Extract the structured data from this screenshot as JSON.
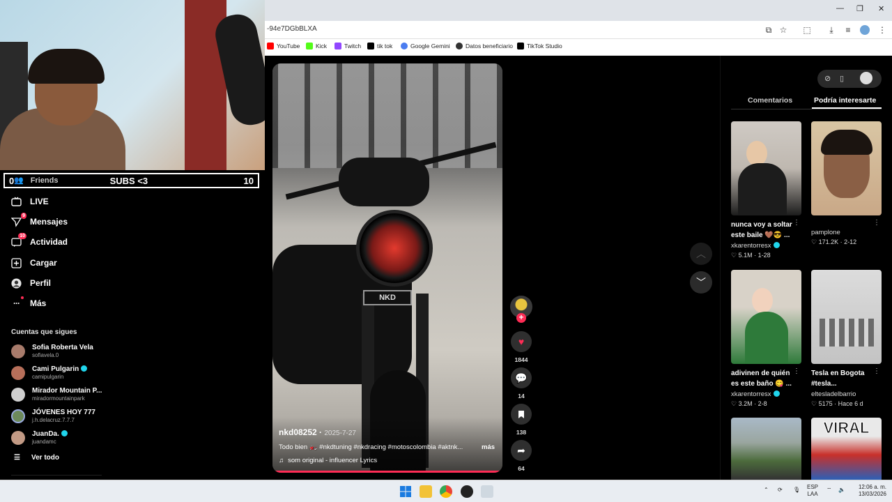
{
  "browser": {
    "url": "-94e7DGbBLXA",
    "window_controls": [
      "—",
      "❐",
      "✕"
    ],
    "bookmarks": [
      {
        "label": "YouTube",
        "color": "#ff0000"
      },
      {
        "label": "Kick",
        "color": "#53fc18"
      },
      {
        "label": "Twitch",
        "color": "#9146ff"
      },
      {
        "label": "tik tok",
        "color": "#000000"
      },
      {
        "label": "Google Gemini",
        "color": "#4a7cf0"
      },
      {
        "label": "Datos beneficiario",
        "color": "#333333"
      },
      {
        "label": "TikTok Studio",
        "color": "#000000"
      }
    ]
  },
  "stream_overlay": {
    "left_value": "0",
    "title": "SUBS <3",
    "right_value": "10"
  },
  "sidebar": {
    "friends_label": "Friends",
    "items": [
      {
        "label": "LIVE",
        "icon": "live-icon",
        "badge": ""
      },
      {
        "label": "Mensajes",
        "icon": "messages-icon",
        "badge": "9"
      },
      {
        "label": "Actividad",
        "icon": "activity-icon",
        "badge": "10"
      },
      {
        "label": "Cargar",
        "icon": "upload-icon",
        "badge": ""
      },
      {
        "label": "Perfil",
        "icon": "profile-icon",
        "badge": ""
      },
      {
        "label": "Más",
        "icon": "more-icon",
        "badge": ""
      }
    ],
    "following_title": "Cuentas que sigues",
    "following": [
      {
        "name": "Sofia Roberta Vela",
        "handle": "sofiavela.0",
        "verified": false,
        "color": "#a87b6b"
      },
      {
        "name": "Cami Pulgarin",
        "handle": "camipulgarin",
        "verified": true,
        "color": "#b76f5a"
      },
      {
        "name": "Mirador Mountain P...",
        "handle": "miradormountainpark",
        "verified": false,
        "color": "#cfcfcf"
      },
      {
        "name": "JÓVENES HOY 777",
        "handle": "j.h.delacruz.7.7.7",
        "verified": false,
        "color": "#6d8a5b"
      },
      {
        "name": "JuanDa.",
        "handle": "juandamc",
        "verified": true,
        "color": "#c29a85"
      }
    ],
    "see_all": "Ver todo"
  },
  "video": {
    "author": "nkd08252",
    "date": "2025-7-27",
    "caption": "Todo bien 🏍️ #nkdtuning #nkdracing #motoscolombia #aktnk...",
    "more": "más",
    "music": "som original - influencer Lyrics",
    "plate_text": "NKD",
    "actions": {
      "likes": "1844",
      "comments": "14",
      "saves": "138",
      "shares": "64"
    }
  },
  "panel": {
    "tabs": [
      "Comentarios",
      "Podría interesarte"
    ],
    "active_tab": "Podría interesarte",
    "cards": [
      {
        "title": "nunca voy a soltar este baile 🤎😎 ...",
        "author": "xkarentorresx",
        "verified": true,
        "likes": "5.1M",
        "date": "1-28",
        "color_a": "#cfcac4",
        "color_b": "#1c1c1c"
      },
      {
        "title": "",
        "author": "pamplone",
        "verified": false,
        "likes": "171.2K",
        "date": "2-12",
        "color_a": "#d9c6a4",
        "color_b": "#8a5f45"
      },
      {
        "title": "adivinen de quién es este baño 😋 ...",
        "author": "xkarentorresx",
        "verified": true,
        "likes": "3.2M",
        "date": "2-8",
        "color_a": "#d8d2c8",
        "color_b": "#2e7a3a"
      },
      {
        "title": "Tesla en Bogota #tesla...",
        "author": "eltesladelbarrio",
        "verified": false,
        "likes": "5175",
        "date": "Hace 6 d",
        "color_a": "#d6d6d6",
        "color_b": "#6a6a6a"
      },
      {
        "title": "",
        "author": "",
        "verified": false,
        "likes": "",
        "date": "",
        "color_a": "#a9b9c7",
        "color_b": "#4c6b3c"
      },
      {
        "title": "VIRAL",
        "author": "",
        "verified": false,
        "likes": "",
        "date": "",
        "color_a": "#e9e9e9",
        "color_b": "#c8302a"
      }
    ]
  },
  "taskbar": {
    "lang": "ESP",
    "lang2": "LAA",
    "time": "12:06 a. m.",
    "date": "13/03/2026"
  }
}
